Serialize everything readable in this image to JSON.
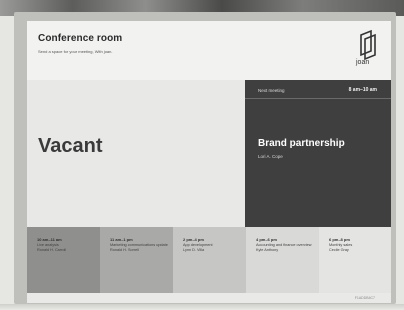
{
  "header": {
    "title": "Conference room",
    "subtitle": "Send a space for your meeting, With joan.",
    "logo_text": "joan"
  },
  "status": {
    "label": "Vacant"
  },
  "next_meeting": {
    "label": "Next meeting",
    "time": "8 am–10 am",
    "title": "Brand partnership",
    "organizer": "Lori A. Cope"
  },
  "timeline": [
    {
      "time": "10 am–11 am",
      "title": "Live analysis",
      "host": "Ronald H. Carroll",
      "bg": "#8f8f8d"
    },
    {
      "time": "11 am–1 pm",
      "title": "Marketing communications update",
      "host": "Ronald H. Sorrell",
      "bg": "#a9a9a7"
    },
    {
      "time": "2 pm–4 pm",
      "title": "App development",
      "host": "Lynn D. Villa",
      "bg": "#c6c6c4"
    },
    {
      "time": "4 pm–6 pm",
      "title": "Accounting and finance overview",
      "host": "Kyle Anthony",
      "bg": "#d9d9d8"
    },
    {
      "time": "6 pm–8 pm",
      "title": "Monthly sales",
      "host": "Cecile Gray",
      "bg": "#e4e4e3"
    }
  ],
  "footer": {
    "serial": "F1ADDB4C7"
  }
}
